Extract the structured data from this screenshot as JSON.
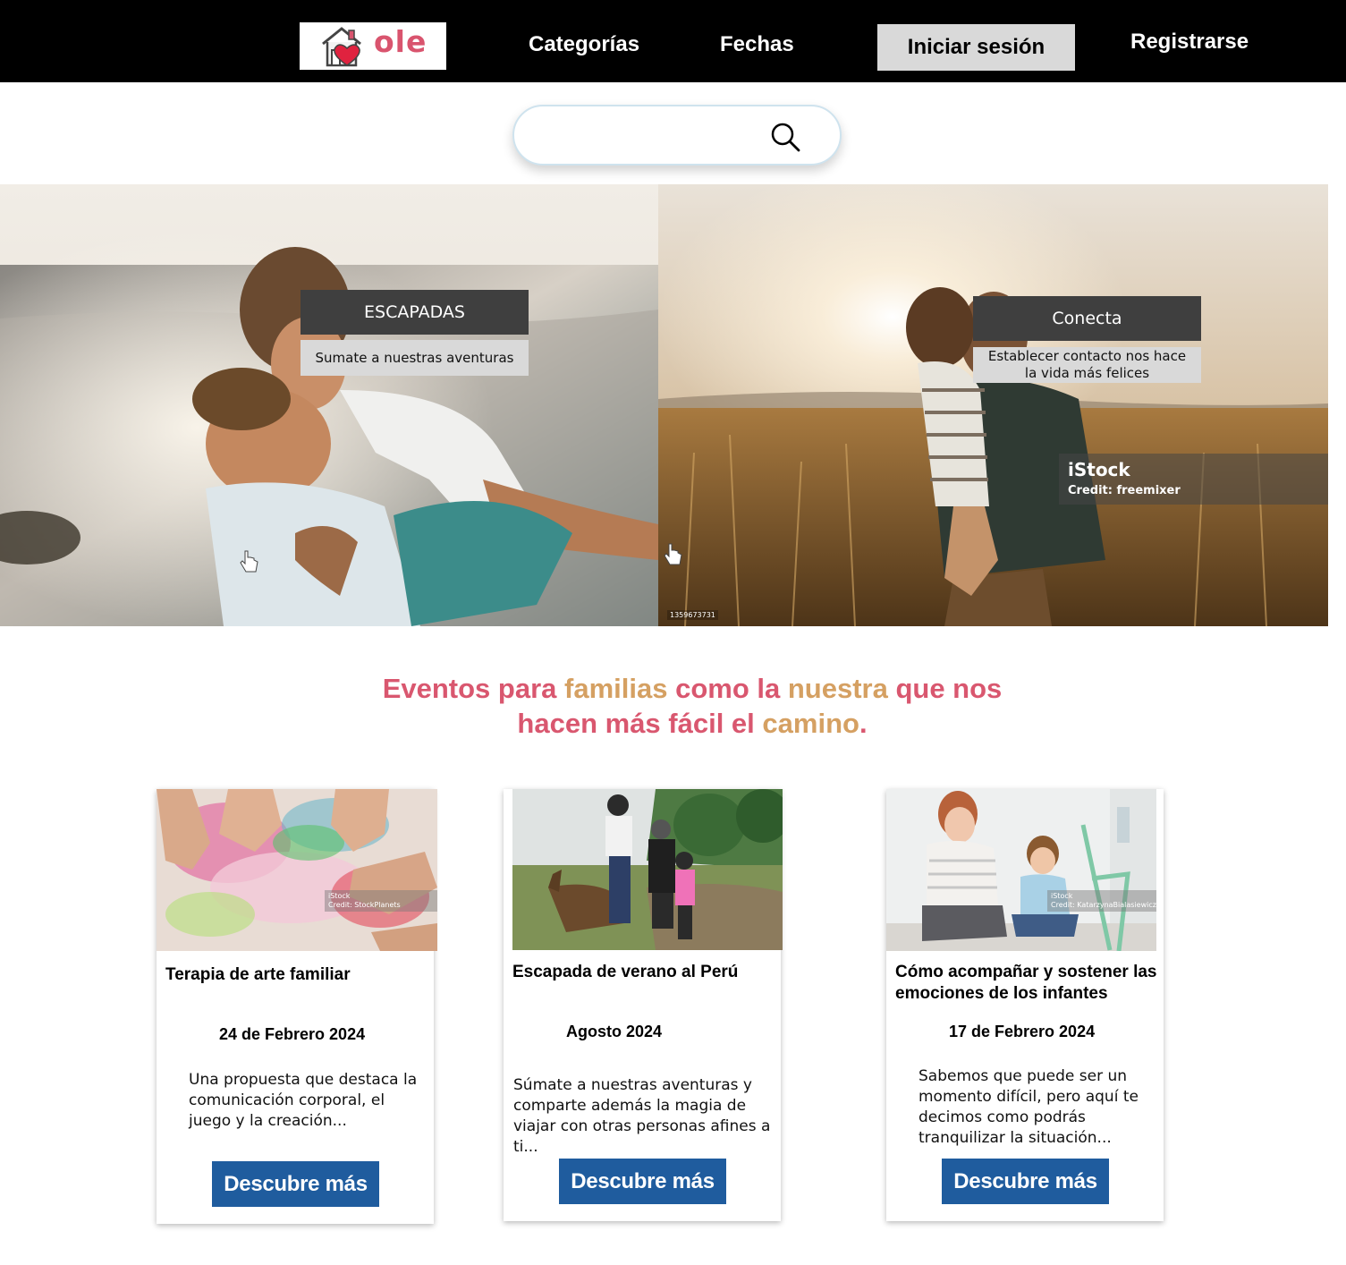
{
  "nav": {
    "logo_text": "ole",
    "categories_label": "Categorías",
    "dates_label": "Fechas",
    "login_label": "Iniciar sesión",
    "register_label": "Registrarse"
  },
  "search": {
    "placeholder": ""
  },
  "hero": [
    {
      "title": "ESCAPADAS",
      "subtitle": "Sumate a nuestras aventuras"
    },
    {
      "title": "Conecta",
      "subtitle": "Establecer contacto nos hace la vida más felices",
      "istock_logo": "iStock",
      "istock_credit": "Credit: freemixer",
      "stock_id": "1359673731"
    }
  ],
  "headline": {
    "parts": [
      {
        "text": "Eventos para ",
        "accent": false
      },
      {
        "text": "familias",
        "accent": true
      },
      {
        "text": " como la ",
        "accent": false
      },
      {
        "text": "nuestra",
        "accent": true
      },
      {
        "text": " que nos hacen más fácil el ",
        "accent": false
      },
      {
        "text": "camino",
        "accent": true
      },
      {
        "text": ".",
        "accent": false
      }
    ]
  },
  "cards": [
    {
      "title": "Terapia de arte familiar",
      "date": "24 de Febrero 2024",
      "description": "Una propuesta que destaca la comunicación corporal, el juego y la creación...",
      "button": "Descubre más",
      "istock_logo": "iStock",
      "istock_credit": "Credit: StockPlanets"
    },
    {
      "title": "Escapada de verano al Perú",
      "date": "Agosto 2024",
      "description": "Súmate a nuestras aventuras y comparte además la magia de viajar con otras personas afines a ti...",
      "button": "Descubre más"
    },
    {
      "title": "Cómo acompañar y sostener las emociones de los infantes",
      "date": "17 de Febrero 2024",
      "description": "Sabemos que puede ser un momento difícil, pero aquí te decimos como podrás tranquilizar la situación...",
      "button": "Descubre más",
      "istock_logo": "iStock",
      "istock_credit": "Credit: KatarzynaBialasiewicz"
    }
  ],
  "colors": {
    "headline": "#d9576f",
    "accent": "#d5a062",
    "button": "#1f5c9e",
    "nav_bg": "#000000"
  }
}
